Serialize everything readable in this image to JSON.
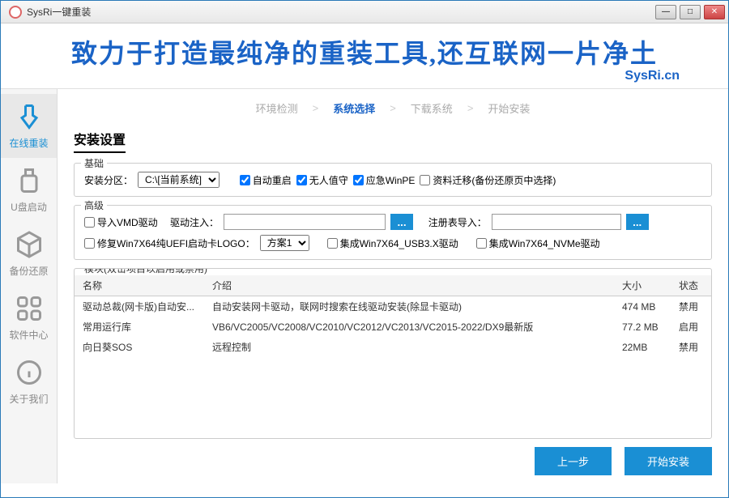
{
  "window": {
    "title": "SysRi一键重装"
  },
  "hero": {
    "title": "致力于打造最纯净的重装工具,还互联网一片净土",
    "subtitle": "SysRi.cn"
  },
  "sidebar": {
    "items": [
      {
        "label": "在线重装"
      },
      {
        "label": "U盘启动"
      },
      {
        "label": "备份还原"
      },
      {
        "label": "软件中心"
      },
      {
        "label": "关于我们"
      }
    ]
  },
  "steps": {
    "items": [
      "环境检测",
      "系统选择",
      "下载系统",
      "开始安装"
    ],
    "sep": ">"
  },
  "page_title": "安装设置",
  "basic": {
    "legend": "基础",
    "partition_label": "安装分区：",
    "partition_value": "C:\\[当前系统]",
    "auto_restart": "自动重启",
    "unattended": "无人值守",
    "winpe": "应急WinPE",
    "data_migrate": "资料迁移(备份还原页中选择)"
  },
  "advanced": {
    "legend": "高级",
    "import_vmd": "导入VMD驱动",
    "driver_inject_label": "驱动注入：",
    "registry_import_label": "注册表导入：",
    "fix_uefi": "修复Win7X64纯UEFI启动卡LOGO：",
    "scheme_value": "方案1",
    "usb3": "集成Win7X64_USB3.X驱动",
    "nvme": "集成Win7X64_NVMe驱动",
    "browse": "..."
  },
  "modules": {
    "legend": "模块(双击项目以启用或禁用)",
    "headers": {
      "name": "名称",
      "desc": "介绍",
      "size": "大小",
      "status": "状态"
    },
    "rows": [
      {
        "name": "驱动总裁(网卡版)自动安...",
        "desc": "自动安装网卡驱动，联网时搜索在线驱动安装(除显卡驱动)",
        "size": "474 MB",
        "status": "禁用"
      },
      {
        "name": "常用运行库",
        "desc": "VB6/VC2005/VC2008/VC2010/VC2012/VC2013/VC2015-2022/DX9最新版",
        "size": "77.2 MB",
        "status": "启用"
      },
      {
        "name": "向日葵SOS",
        "desc": "远程控制",
        "size": "22MB",
        "status": "禁用"
      }
    ]
  },
  "footer": {
    "prev": "上一步",
    "install": "开始安装"
  }
}
